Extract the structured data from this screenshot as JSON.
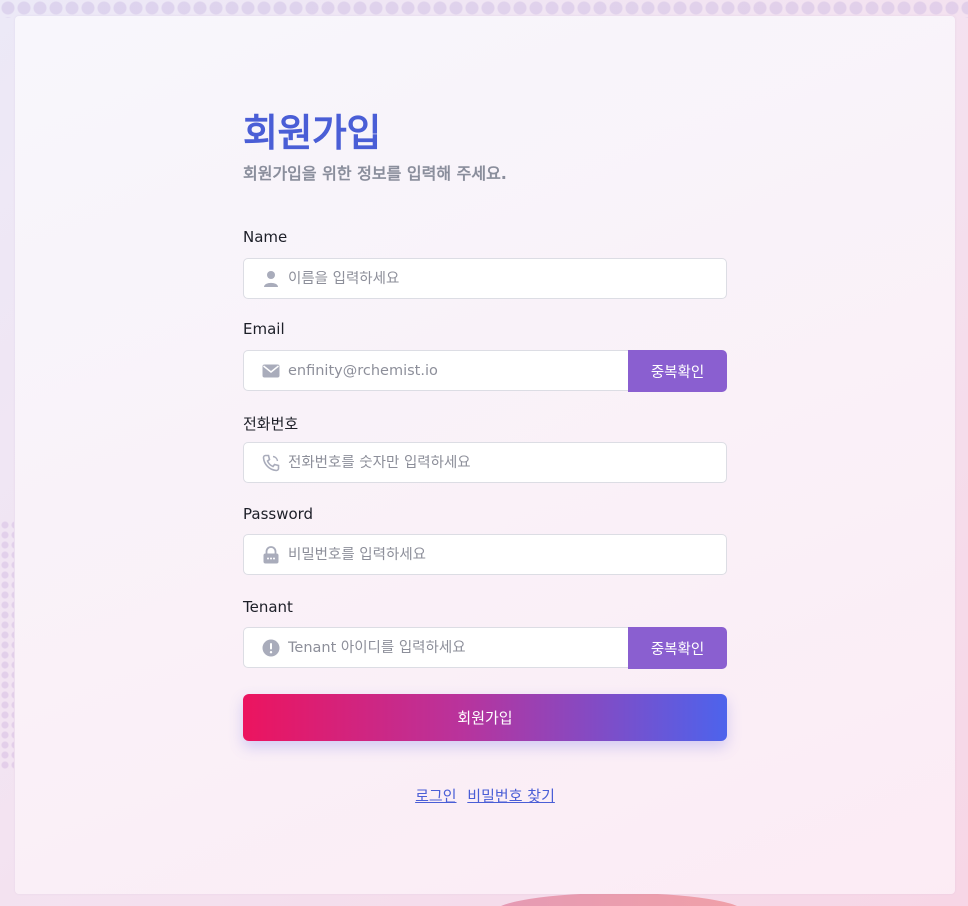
{
  "form": {
    "title": "회원가입",
    "subtitle": "회원가입을 위한 정보를 입력해 주세요.",
    "fields": {
      "name": {
        "label": "Name",
        "placeholder": "이름을 입력하세요",
        "icon": "user-icon"
      },
      "email": {
        "label": "Email",
        "placeholder": "enfinity@rchemist.io",
        "icon": "mail-icon",
        "check_button": "중복확인"
      },
      "phone": {
        "label": "전화번호",
        "placeholder": "전화번호를 숫자만 입력하세요",
        "icon": "phone-icon"
      },
      "password": {
        "label": "Password",
        "placeholder": "비밀번호를 입력하세요",
        "icon": "lock-icon"
      },
      "tenant": {
        "label": "Tenant",
        "placeholder": "Tenant 아이디를 입력하세요",
        "icon": "info-icon",
        "check_button": "중복확인"
      }
    },
    "submit_label": "회원가입",
    "links": {
      "login": "로그인",
      "find_password": "비밀번호 찾기"
    }
  },
  "colors": {
    "accent": "#4a5ed6",
    "check_button": "#8a5fd0",
    "gradient_start": "#ec145f",
    "gradient_end": "#4d63ec"
  }
}
